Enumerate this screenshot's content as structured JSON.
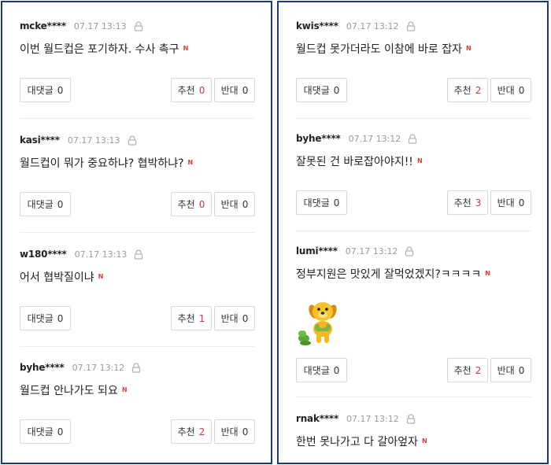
{
  "colors": {
    "frame": "#1b3a7a",
    "new_badge": "#e03c31",
    "count_red": "#d2363b"
  },
  "icons": {
    "lock": "lock-icon",
    "new": "new-badge-icon"
  },
  "new_badge": "N",
  "labels": {
    "reply": "대댓글",
    "up": "추천",
    "down": "반대"
  },
  "left_comments": [
    {
      "nick": "mcke****",
      "time": "07.17 13:13",
      "text": "이번 월드컵은 포기하자. 수사 촉구",
      "reply_count": "0",
      "up_count": "0",
      "down_count": "0"
    },
    {
      "nick": "kasi****",
      "time": "07.17 13:13",
      "text": "월드컵이 뭐가 중요하냐? 협박하냐?",
      "reply_count": "0",
      "up_count": "0",
      "down_count": "0"
    },
    {
      "nick": "w180****",
      "time": "07.17 13:13",
      "text": "어서 협박질이냐",
      "reply_count": "0",
      "up_count": "1",
      "down_count": "0"
    },
    {
      "nick": "byhe****",
      "time": "07.17 13:12",
      "text": "월드컵 안나가도 되요",
      "reply_count": "0",
      "up_count": "2",
      "down_count": "0"
    }
  ],
  "right_comments": [
    {
      "nick": "kwis****",
      "time": "07.17 13:12",
      "text": "월드컵 못가더라도 이참에 바로 잡자",
      "reply_count": "0",
      "up_count": "2",
      "down_count": "0"
    },
    {
      "nick": "byhe****",
      "time": "07.17 13:12",
      "text": "잘못된 건 바로잡아야지!!",
      "reply_count": "0",
      "up_count": "3",
      "down_count": "0"
    },
    {
      "nick": "lumi****",
      "time": "07.17 13:12",
      "text": "정부지원은 맛있게 잘먹었겠지?ㅋㅋㅋㅋ",
      "reply_count": "0",
      "up_count": "2",
      "down_count": "0",
      "sticker": "dog-sticker"
    },
    {
      "nick": "rnak****",
      "time": "07.17 13:12",
      "text": "한번 못나가고 다 갈아엎자",
      "reply_count": "0",
      "up_count": "2",
      "down_count": "0"
    }
  ]
}
